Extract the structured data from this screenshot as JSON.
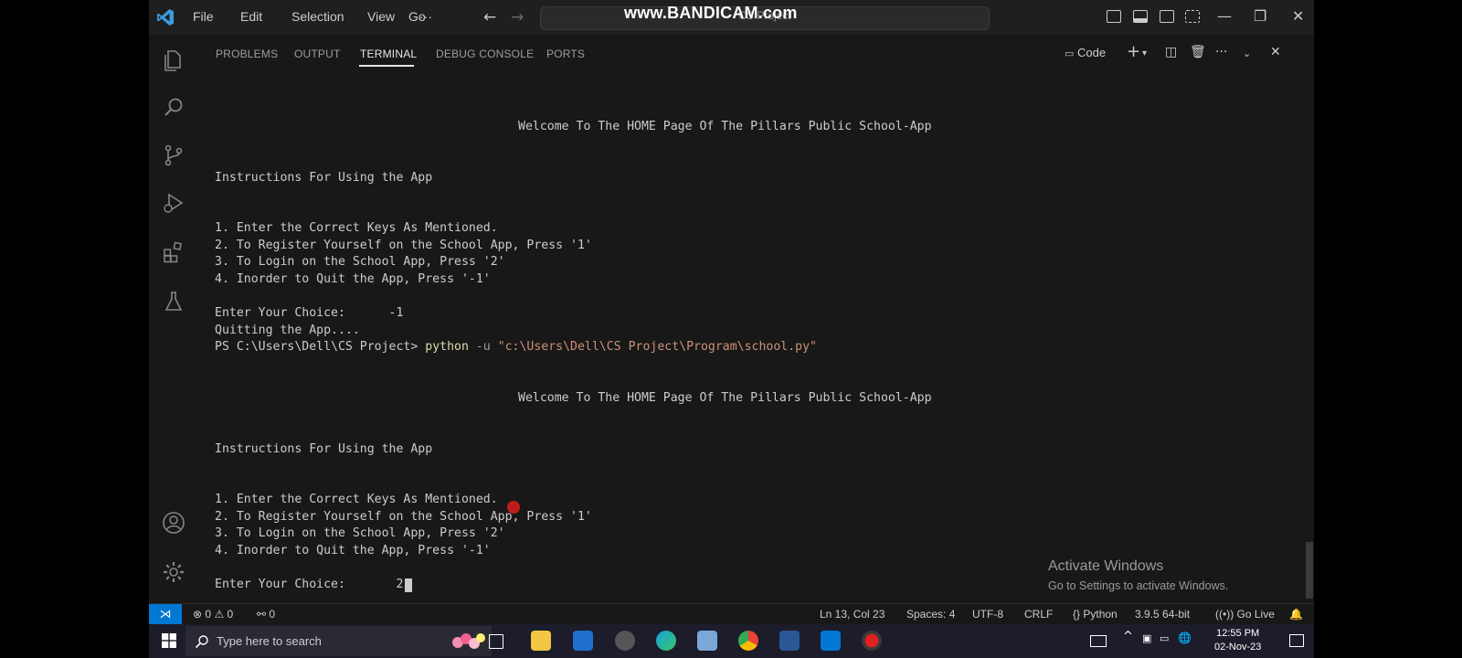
{
  "titlebar": {
    "menu": [
      "File",
      "Edit",
      "Selection",
      "View",
      "Go",
      "···"
    ],
    "command_center": "CS Project",
    "watermark": "www.BANDICAM.com"
  },
  "panel": {
    "tabs": [
      "PROBLEMS",
      "OUTPUT",
      "TERMINAL",
      "DEBUG CONSOLE",
      "PORTS"
    ],
    "active_tab": "TERMINAL",
    "terminal_profile": "Code"
  },
  "terminal": {
    "welcome_1": "Welcome To The HOME Page Of The Pillars Public School-App",
    "instructions_1": "Instructions For Using the App",
    "step1_1": "1. Enter the Correct Keys As Mentioned.",
    "step2_1": "2. To Register Yourself on the School App, Press '1'",
    "step3_1": "3. To Login on the School App, Press '2'",
    "step4_1": "4. Inorder to Quit the App, Press '-1'",
    "choice_1": "Enter Your Choice:      -1",
    "quitting": "Quitting the App....",
    "prompt": "PS C:\\Users\\Dell\\CS Project> ",
    "cmd_python": "python",
    "cmd_flag": " -u ",
    "cmd_path": "\"c:\\Users\\Dell\\CS Project\\Program\\school.py\"",
    "welcome_2": "Welcome To The HOME Page Of The Pillars Public School-App",
    "instructions_2": "Instructions For Using the App",
    "step1_2": "1. Enter the Correct Keys As Mentioned.",
    "step2_2": "2. To Register Yourself on the School App, Press '1'",
    "step3_2": "3. To Login on the School App, Press '2'",
    "step4_2": "4. Inorder to Quit the App, Press '-1'",
    "choice_2": "Enter Your Choice:       2"
  },
  "activate_windows": {
    "title": "Activate Windows",
    "subtitle": "Go to Settings to activate Windows."
  },
  "statusbar": {
    "errors": "0",
    "warnings": "0",
    "ports": "0",
    "position": "Ln 13, Col 23",
    "spaces": "Spaces: 4",
    "encoding": "UTF-8",
    "eol": "CRLF",
    "language": "Python",
    "interpreter": "3.9.5 64-bit",
    "golive": "Go Live"
  },
  "taskbar": {
    "search_placeholder": "Type here to search",
    "time": "12:55 PM",
    "date": "02-Nov-23"
  },
  "colors": {
    "accent": "#0078d4",
    "background": "#181818",
    "string": "#ce9178",
    "function": "#dcdcaa"
  }
}
